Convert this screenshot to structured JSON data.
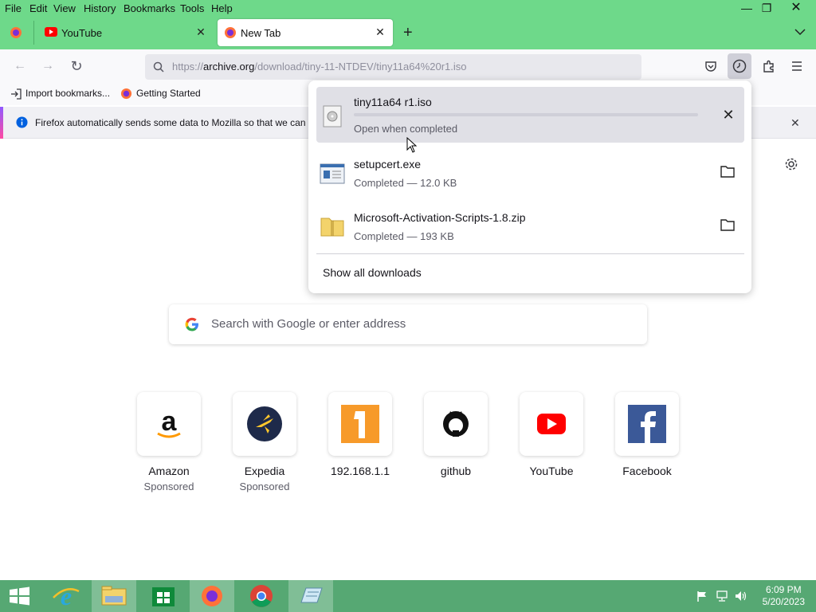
{
  "menubar": {
    "items": [
      "File",
      "Edit",
      "View",
      "History",
      "Bookmarks",
      "Tools",
      "Help"
    ]
  },
  "tabs": [
    {
      "label": "YouTube",
      "active": false
    },
    {
      "label": "New Tab",
      "active": true
    }
  ],
  "urlbar": {
    "prefix": "https://",
    "host": "archive.org",
    "path": "/download/tiny-11-NTDEV/tiny11a64%20r1.iso"
  },
  "bookmarks": [
    {
      "label": "Import bookmarks..."
    },
    {
      "label": "Getting Started"
    }
  ],
  "notice": {
    "text": "Firefox automatically sends some data to Mozilla so that we can i"
  },
  "downloads": {
    "items": [
      {
        "name": "tiny11a64 r1.iso",
        "status": "Open when completed",
        "progress": 0.0
      },
      {
        "name": "setupcert.exe",
        "status": "Completed — 12.0 KB"
      },
      {
        "name": "Microsoft-Activation-Scripts-1.8.zip",
        "status": "Completed — 193 KB"
      }
    ],
    "show_all": "Show all downloads"
  },
  "search": {
    "placeholder": "Search with Google or enter address"
  },
  "shortcuts": [
    {
      "name": "Amazon",
      "sponsored": "Sponsored",
      "icon": "amazon-icon"
    },
    {
      "name": "Expedia",
      "sponsored": "Sponsored",
      "icon": "expedia-icon"
    },
    {
      "name": "192.168.1.1",
      "sponsored": "",
      "icon": "letter-1-icon"
    },
    {
      "name": "github",
      "sponsored": "",
      "icon": "github-icon"
    },
    {
      "name": "YouTube",
      "sponsored": "",
      "icon": "youtube-icon"
    },
    {
      "name": "Facebook",
      "sponsored": "",
      "icon": "facebook-icon"
    }
  ],
  "taskbar": {
    "time": "6:09 PM",
    "date": "5/20/2023"
  },
  "colors": {
    "chrome_green": "#6ed98a",
    "taskbar_green": "#56a873",
    "accent": "#0060df"
  }
}
